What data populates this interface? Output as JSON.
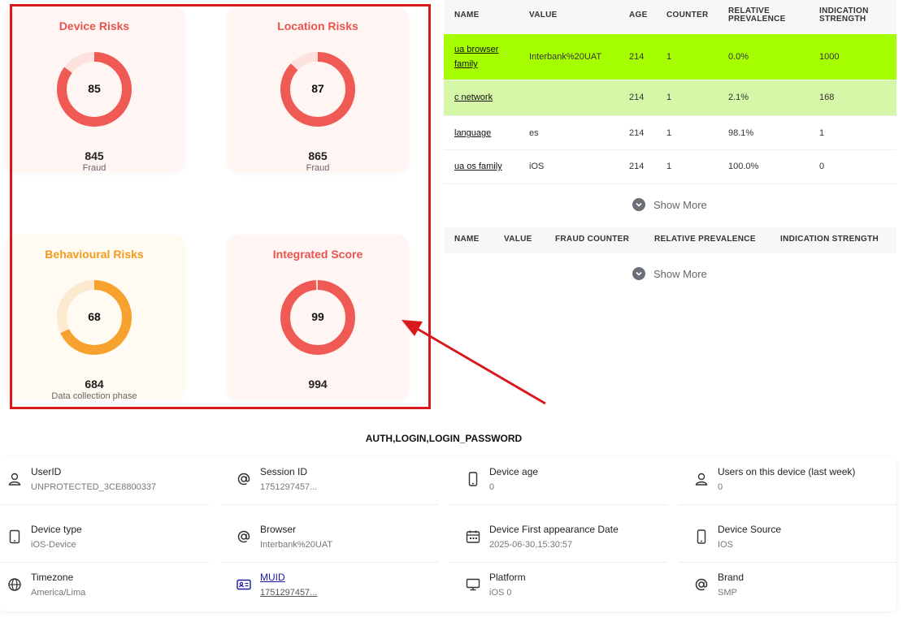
{
  "colors": {
    "red": "#f05a55",
    "red_track": "#fde1dd",
    "orange": "#f7a12e",
    "orange_track": "#fde9cf",
    "lime_row": "#a6ff00",
    "light_lime_row": "#d6f7a8",
    "annotation": "#d9181e"
  },
  "risks": [
    {
      "title": "Device Risks",
      "score": 85,
      "fraction": 0.85,
      "count": "845",
      "sub": "Fraud",
      "color": "red"
    },
    {
      "title": "Location Risks",
      "score": 87,
      "fraction": 0.87,
      "count": "865",
      "sub": "Fraud",
      "color": "red"
    },
    {
      "title": "Behavioural Risks",
      "score": 68,
      "fraction": 0.68,
      "count": "684",
      "sub": "Data collection phase",
      "color": "orange"
    },
    {
      "title": "Integrated Score",
      "score": 99,
      "fraction": 0.99,
      "count": "994",
      "sub": "",
      "color": "red"
    }
  ],
  "device_table": {
    "headers": [
      "NAME",
      "VALUE",
      "AGE",
      "COUNTER",
      "RELATIVE PREVALENCE",
      "INDICATION STRENGTH"
    ],
    "rows": [
      {
        "name": "ua browser family",
        "value": "Interbank%20UAT",
        "age": "214",
        "counter": "1",
        "prevalence": "0.0%",
        "strength": "1000",
        "highlight": "lime_row"
      },
      {
        "name": "c network",
        "value": "",
        "age": "214",
        "counter": "1",
        "prevalence": "2.1%",
        "strength": "168",
        "highlight": "light_lime_row"
      },
      {
        "name": "language",
        "value": "es",
        "age": "214",
        "counter": "1",
        "prevalence": "98.1%",
        "strength": "1",
        "highlight": ""
      },
      {
        "name": "ua os family",
        "value": "iOS",
        "age": "214",
        "counter": "1",
        "prevalence": "100.0%",
        "strength": "0",
        "highlight": ""
      }
    ],
    "show_more": "Show More"
  },
  "fraud_table": {
    "headers": [
      "NAME",
      "VALUE",
      "FRAUD COUNTER",
      "RELATIVE PREVALENCE",
      "INDICATION STRENGTH"
    ],
    "show_more": "Show More"
  },
  "auth_title": "AUTH,LOGIN,LOGIN_PASSWORD",
  "info": [
    {
      "label": "UserID",
      "value": "UNPROTECTED_3CE8800337",
      "icon": "user-icon"
    },
    {
      "label": "Session ID",
      "value": "1751297457...",
      "icon": "at-icon"
    },
    {
      "label": "Device age",
      "value": "0",
      "icon": "phone-icon"
    },
    {
      "label": "Users on this device (last week)",
      "value": "0",
      "icon": "user-icon"
    },
    {
      "label": "Device type",
      "value": "iOS-Device",
      "icon": "tablet-icon"
    },
    {
      "label": "Browser",
      "value": "Interbank%20UAT",
      "icon": "at-icon"
    },
    {
      "label": "Device First appearance Date",
      "value": "2025-06-30,15:30:57",
      "icon": "calendar-icon"
    },
    {
      "label": "Device Source",
      "value": "IOS",
      "icon": "phone-icon"
    },
    {
      "label": "Timezone",
      "value": "America/Lima",
      "icon": "globe-icon"
    },
    {
      "label": "MUID",
      "value": "1751297457...",
      "icon": "id-card-icon"
    },
    {
      "label": "Platform",
      "value": "iOS 0",
      "icon": "monitor-icon"
    },
    {
      "label": "Brand",
      "value": "SMP",
      "icon": "at-icon"
    }
  ]
}
